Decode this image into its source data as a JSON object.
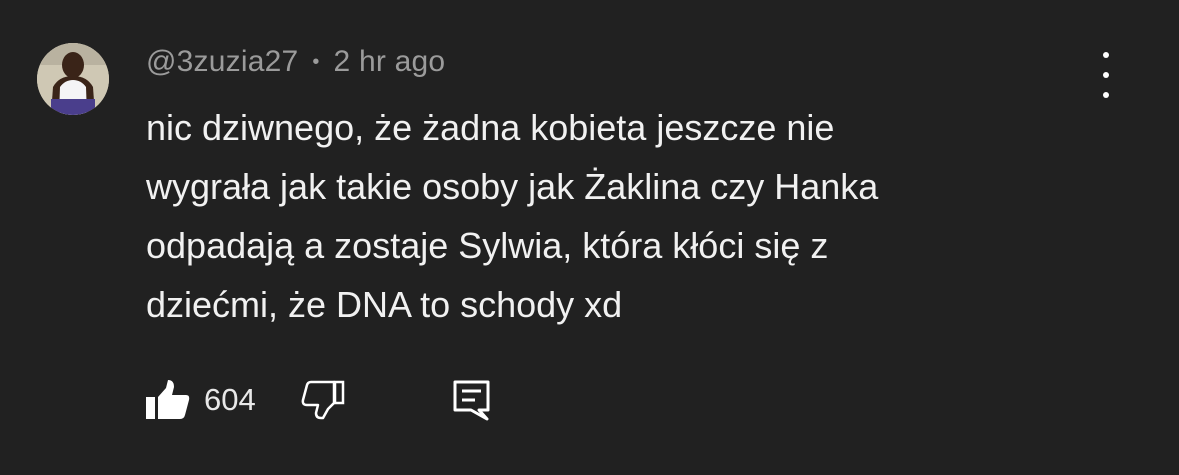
{
  "comment": {
    "username": "@3zuzia27",
    "separator": "•",
    "timestamp": "2 hr ago",
    "text_lines": [
      "nic dziwnego, że żadna kobieta jeszcze nie",
      "wygrała jak takie osoby jak Żaklina czy Hanka",
      "odpadają a zostaje Sylwia, która kłóci się z",
      "dziećmi, że DNA to schody xd"
    ],
    "like_count": "604"
  },
  "icons": {
    "avatar": "avatar-image",
    "like": "thumbs-up-icon",
    "dislike": "thumbs-down-icon",
    "reply": "reply-comment-icon",
    "menu": "more-vertical-icon"
  },
  "colors": {
    "background": "#212121",
    "text": "#f1f1f1",
    "meta": "#9b9b9b"
  }
}
